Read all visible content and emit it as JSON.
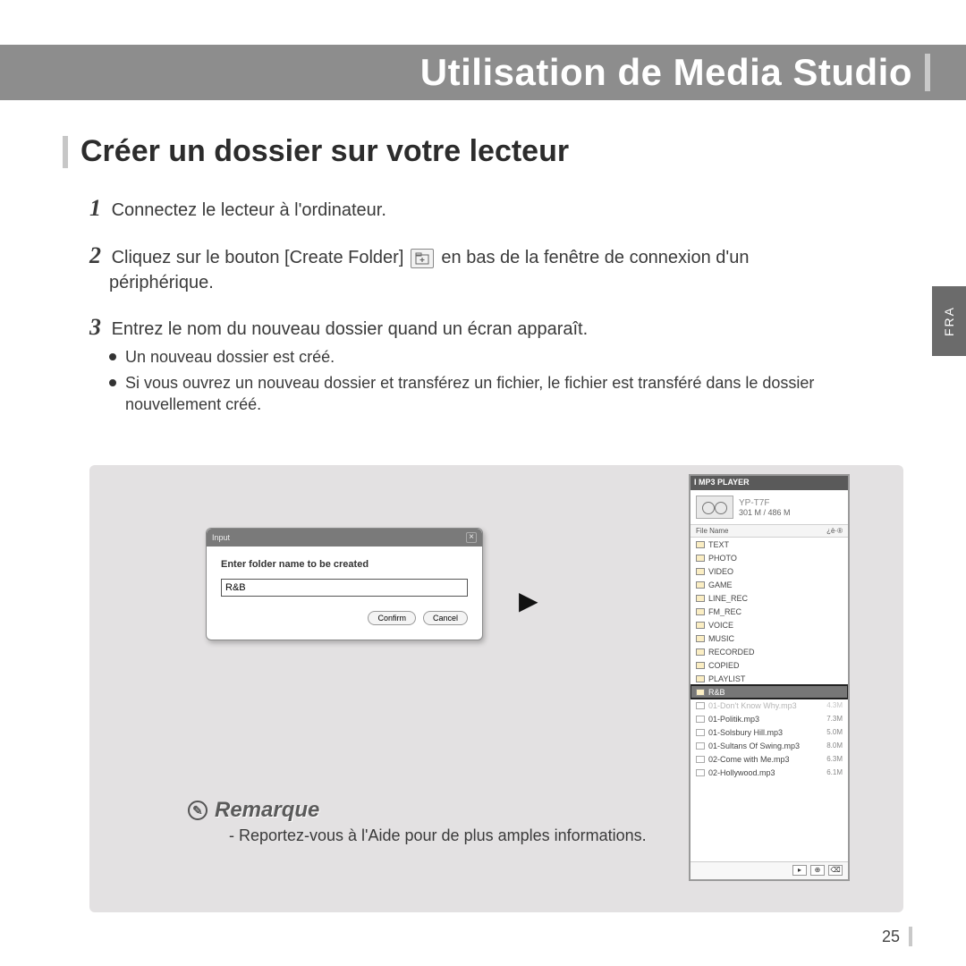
{
  "header": {
    "title": "Utilisation de Media Studio"
  },
  "section": {
    "title": "Créer un dossier sur votre lecteur"
  },
  "side_tab": "FRA",
  "steps": {
    "s1": {
      "num": "1",
      "text": "Connectez le lecteur à l'ordinateur."
    },
    "s2": {
      "num": "2",
      "text_a": "Cliquez sur le bouton [Create Folder]",
      "text_b": "en bas de la fenêtre de connexion d'un",
      "text_c": "périphérique."
    },
    "s3": {
      "num": "3",
      "text": "Entrez le nom du nouveau dossier quand un écran apparaît."
    },
    "bullets": [
      "Un nouveau dossier est créé.",
      "Si vous ouvrez un nouveau dossier et transférez un fichier, le fichier est transféré dans le dossier nouvellement créé."
    ]
  },
  "dialog": {
    "title": "Input",
    "label": "Enter folder name to be created",
    "value": "R&B",
    "confirm": "Confirm",
    "cancel": "Cancel"
  },
  "device": {
    "head": "I MP3 PLAYER",
    "name": "YP-T7F",
    "storage": "301 M / 486 M",
    "col1": "File Name",
    "col2": "¿è·®",
    "folders": [
      "TEXT",
      "PHOTO",
      "VIDEO",
      "GAME",
      "LINE_REC",
      "FM_REC",
      "VOICE",
      "MUSIC",
      "RECORDED",
      "COPIED",
      "PLAYLIST"
    ],
    "selected": "R&B",
    "faded_file": {
      "name": "01-Don't Know Why.mp3",
      "size": "4.3M"
    },
    "files": [
      {
        "name": "01-Politik.mp3",
        "size": "7.3M"
      },
      {
        "name": "01-Solsbury Hill.mp3",
        "size": "5.0M"
      },
      {
        "name": "01-Sultans Of Swing.mp3",
        "size": "8.0M"
      },
      {
        "name": "02-Come with Me.mp3",
        "size": "6.3M"
      },
      {
        "name": "02-Hollywood.mp3",
        "size": "6.1M"
      }
    ]
  },
  "remarque": {
    "title": "Remarque",
    "text": "- Reportez-vous à l'Aide pour de plus amples informations."
  },
  "page_number": "25"
}
